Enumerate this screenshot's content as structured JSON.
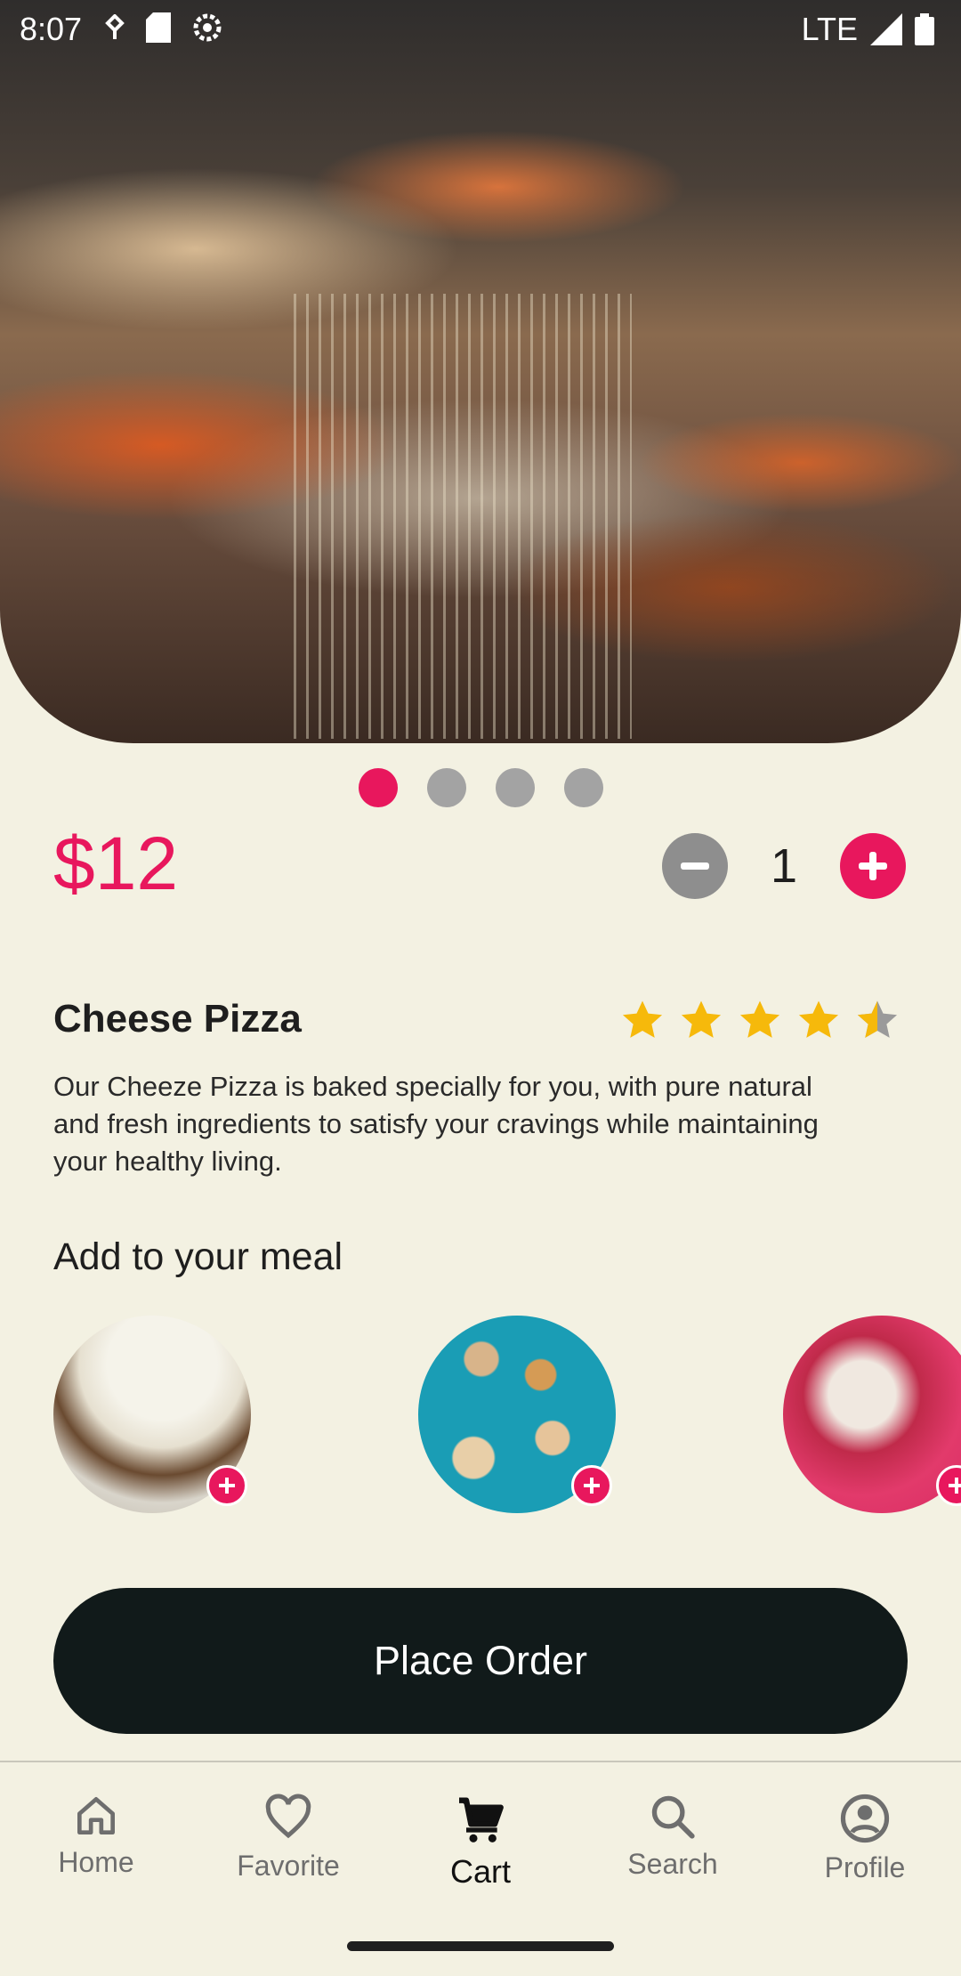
{
  "status_bar": {
    "time": "8:07",
    "network": "LTE"
  },
  "product": {
    "price": "$12",
    "quantity": "1",
    "name": "Cheese Pizza",
    "rating": 4.5,
    "description": "Our Cheeze Pizza is baked specially for you, with pure natural and fresh ingredients to satisfy your cravings while maintaining your healthy living."
  },
  "carousel": {
    "count": 4,
    "active_index": 0
  },
  "addons": {
    "title": "Add to your meal"
  },
  "actions": {
    "place_order": "Place Order"
  },
  "nav": {
    "items": [
      {
        "label": "Home",
        "icon": "home-icon"
      },
      {
        "label": "Favorite",
        "icon": "heart-icon"
      },
      {
        "label": "Cart",
        "icon": "cart-icon"
      },
      {
        "label": "Search",
        "icon": "search-icon"
      },
      {
        "label": "Profile",
        "icon": "profile-icon"
      }
    ],
    "active": "Cart"
  },
  "colors": {
    "accent": "#e8175d",
    "background": "#f3f1e2",
    "button": "#111a1a"
  }
}
